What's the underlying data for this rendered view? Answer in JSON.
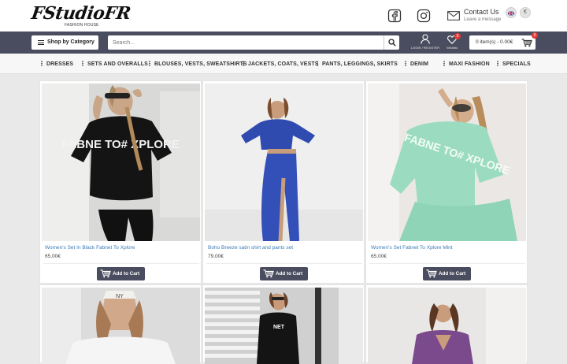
{
  "header": {
    "logo_text": "FStudioFR",
    "logo_sub": "FASHION HOUSE",
    "contact_title": "Contact Us",
    "contact_sub": "Leave a message",
    "currency": "€"
  },
  "toolbar": {
    "category_label": "Shop by Category",
    "search_placeholder": "Search...",
    "login_label": "LOGIN / REGISTER",
    "wishlist_label": "Wishlist",
    "wishlist_count": "0",
    "cart_text": "0 item(s) - 0.00€",
    "cart_count": "0"
  },
  "nav": {
    "items": [
      {
        "label": "DRESSES"
      },
      {
        "label": "SETS AND OVERALLS"
      },
      {
        "label": "BLOUSES, VESTS, SWEATSHIRTS"
      },
      {
        "label": "JACKETS, COATS, VESTS"
      },
      {
        "label": "PANTS, LEGGINGS, SKIRTS"
      },
      {
        "label": "DENIM"
      },
      {
        "label": "MAXI FASHION"
      },
      {
        "label": "SPECIALS"
      }
    ]
  },
  "products": [
    {
      "title": "Women's Set In Black Fabnet To Xplore",
      "price": "65.00€",
      "add_label": "Add to Cart",
      "print_text": "FABNE TO# XPLORE"
    },
    {
      "title": "Boho Breeze satin shirt and pants set",
      "price": "79.00€",
      "add_label": "Add to Cart"
    },
    {
      "title": "Women's Set Fabnet To Xplore Mint",
      "price": "65.00€",
      "add_label": "Add to Cart",
      "print_text": "FABNE TO# XPLORE"
    },
    {
      "title": "",
      "price": "",
      "add_label": "",
      "print_text": "NY"
    },
    {
      "title": "",
      "price": "",
      "add_label": "",
      "print_text": "NET"
    },
    {
      "title": "",
      "price": "",
      "add_label": ""
    }
  ],
  "colors": {
    "dark_bar": "#4a4d5f",
    "link": "#3a7bb7",
    "badge": "#e53935",
    "background": "#e9e9e9"
  }
}
